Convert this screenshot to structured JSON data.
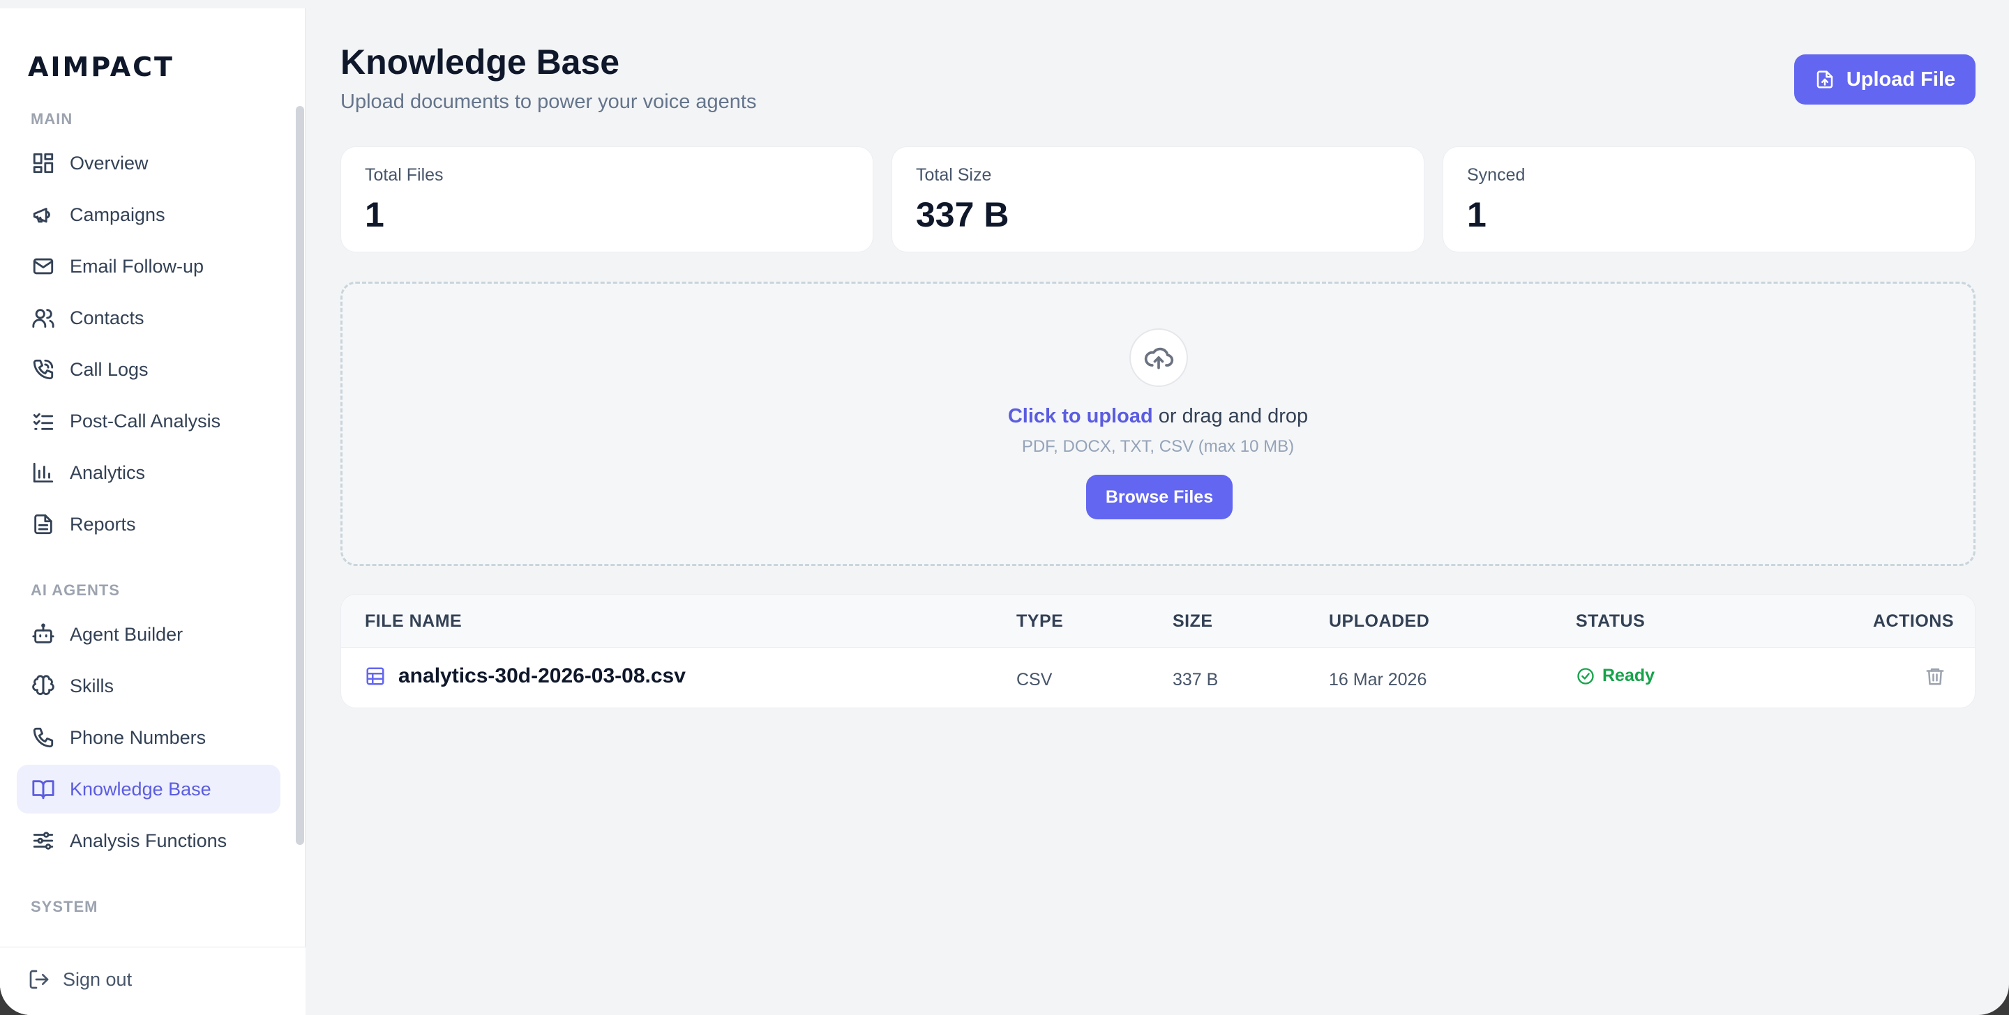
{
  "sidebar": {
    "brand": "AIMPACT",
    "sections": [
      {
        "label": "MAIN"
      },
      {
        "label": "AI AGENTS"
      },
      {
        "label": "SYSTEM"
      }
    ],
    "items": [
      {
        "label": "Overview",
        "icon": "grid-icon"
      },
      {
        "label": "Campaigns",
        "icon": "megaphone-icon"
      },
      {
        "label": "Email Follow-up",
        "icon": "mail-icon"
      },
      {
        "label": "Contacts",
        "icon": "users-icon"
      },
      {
        "label": "Call Logs",
        "icon": "phone-call-icon"
      },
      {
        "label": "Post-Call Analysis",
        "icon": "list-check-icon"
      },
      {
        "label": "Analytics",
        "icon": "bar-chart-icon"
      },
      {
        "label": "Reports",
        "icon": "file-text-icon"
      },
      {
        "label": "Agent Builder",
        "icon": "bot-icon"
      },
      {
        "label": "Skills",
        "icon": "brain-icon"
      },
      {
        "label": "Phone Numbers",
        "icon": "phone-icon"
      },
      {
        "label": "Knowledge Base",
        "icon": "book-open-icon",
        "active": true
      },
      {
        "label": "Analysis Functions",
        "icon": "sliders-icon"
      }
    ],
    "signout": "Sign out"
  },
  "header": {
    "title": "Knowledge Base",
    "subtitle": "Upload documents to power your voice agents",
    "upload_button": "Upload File"
  },
  "stats": [
    {
      "label": "Total Files",
      "value": "1"
    },
    {
      "label": "Total Size",
      "value": "337 B"
    },
    {
      "label": "Synced",
      "value": "1"
    }
  ],
  "dropzone": {
    "link": "Click to upload",
    "text": " or drag and drop",
    "hint": "PDF, DOCX, TXT, CSV (max 10 MB)",
    "browse_button": "Browse Files"
  },
  "table": {
    "columns": [
      "FILE NAME",
      "TYPE",
      "SIZE",
      "UPLOADED",
      "STATUS",
      "ACTIONS"
    ],
    "rows": [
      {
        "file_name": "analytics-30d-2026-03-08.csv",
        "type": "CSV",
        "size": "337 B",
        "uploaded": "16 Mar 2026",
        "status": "Ready"
      }
    ]
  },
  "colors": {
    "accent": "#6366f1",
    "active_bg": "#eef0fd",
    "status_ready": "#16a34a"
  }
}
